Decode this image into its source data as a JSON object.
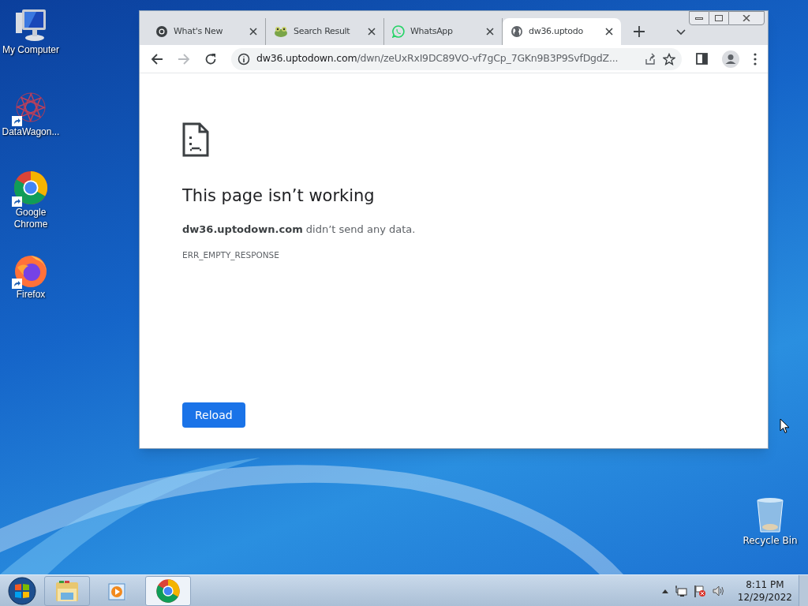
{
  "desktop_icons": [
    {
      "kind": "computer",
      "label": "My Computer",
      "shortcut": false
    },
    {
      "kind": "datawagon",
      "label": "DataWagon...",
      "shortcut": true
    },
    {
      "kind": "chrome",
      "label": "Google Chrome",
      "shortcut": true
    },
    {
      "kind": "firefox",
      "label": "Firefox",
      "shortcut": true
    }
  ],
  "recycle_bin": {
    "label": "Recycle Bin"
  },
  "browser": {
    "tabs": [
      {
        "kind": "chrome",
        "title": "What's New",
        "selected": false
      },
      {
        "kind": "frog",
        "title": "Search Result",
        "selected": false
      },
      {
        "kind": "whatsapp",
        "title": "WhatsApp",
        "selected": false
      },
      {
        "kind": "globe",
        "title": "dw36.uptodo",
        "selected": true
      }
    ],
    "address": {
      "host": "dw36.uptodown.com",
      "path": "/dwn/zeUxRxI9DC89VO-vf7gCp_7GKn9B3P9SvfDgdZ..."
    },
    "error": {
      "title": "This page isn’t working",
      "message": "**dw36.uptodown.com** didn’t send any data.",
      "code": "ERR_EMPTY_RESPONSE",
      "button": "Reload"
    }
  },
  "taskbar": {
    "apps": [
      {
        "kind": "explorer",
        "selected": false
      },
      {
        "kind": "media",
        "selected": false
      },
      {
        "kind": "chrome",
        "selected": true
      }
    ],
    "time": "8:11 PM",
    "date": "12/29/2022"
  }
}
